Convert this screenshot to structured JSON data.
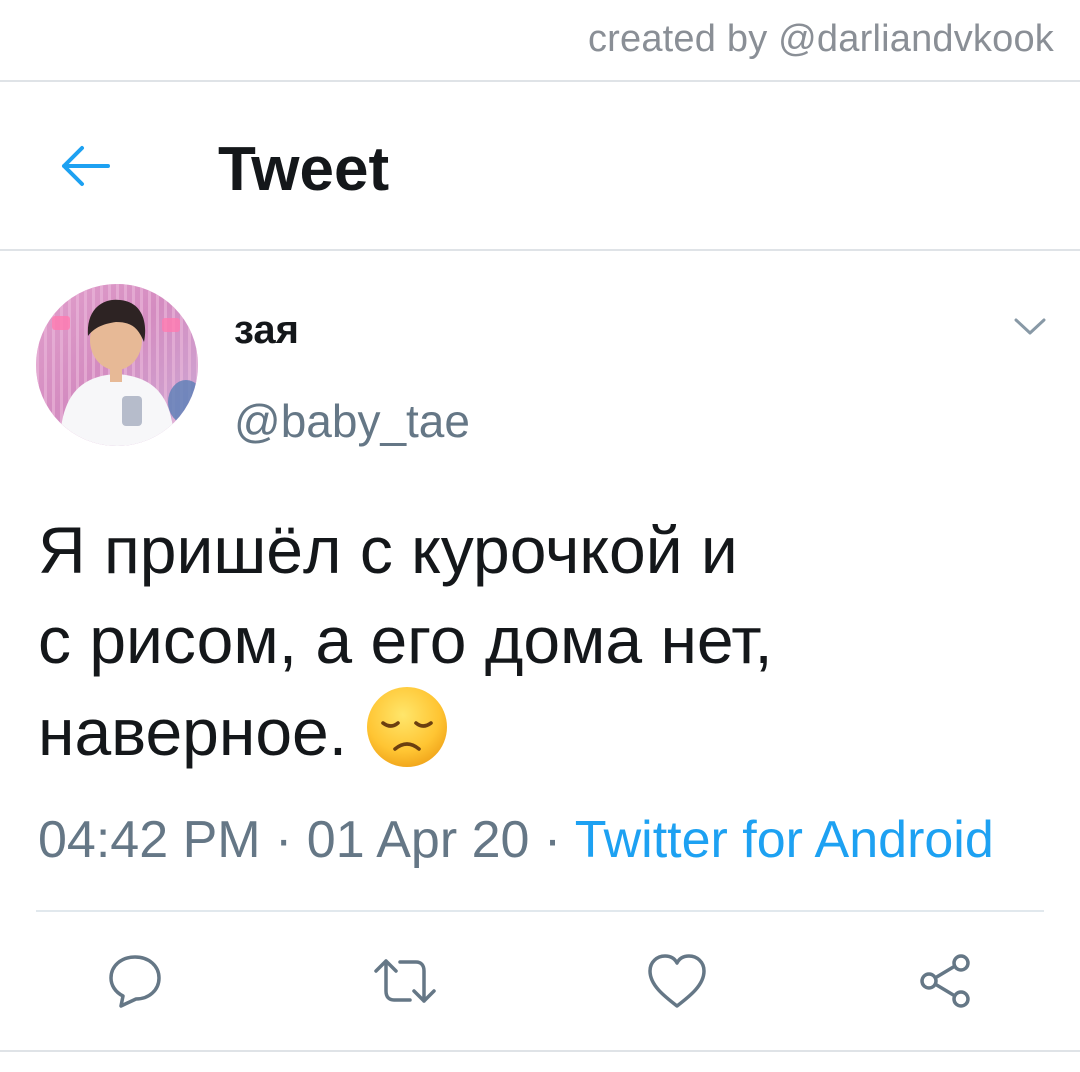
{
  "watermark": "created by @darliandvkook",
  "header": {
    "title": "Tweet",
    "back_icon": "arrow-left-icon"
  },
  "tweet": {
    "display_name": "зая",
    "handle": "@baby_tae",
    "text_lines": [
      "Я пришёл с курочкой и",
      "с рисом, а его дома нет,",
      "наверное."
    ],
    "emoji": "disappointed-face",
    "time": "04:42 PM",
    "separator": " · ",
    "date": "01 Apr 20",
    "source": "Twitter for Android"
  },
  "actions": [
    "reply-icon",
    "retweet-icon",
    "like-icon",
    "share-icon"
  ],
  "colors": {
    "accent": "#1da1f2",
    "text": "#14171a",
    "muted": "#657786",
    "divider": "#e1e8ed"
  }
}
